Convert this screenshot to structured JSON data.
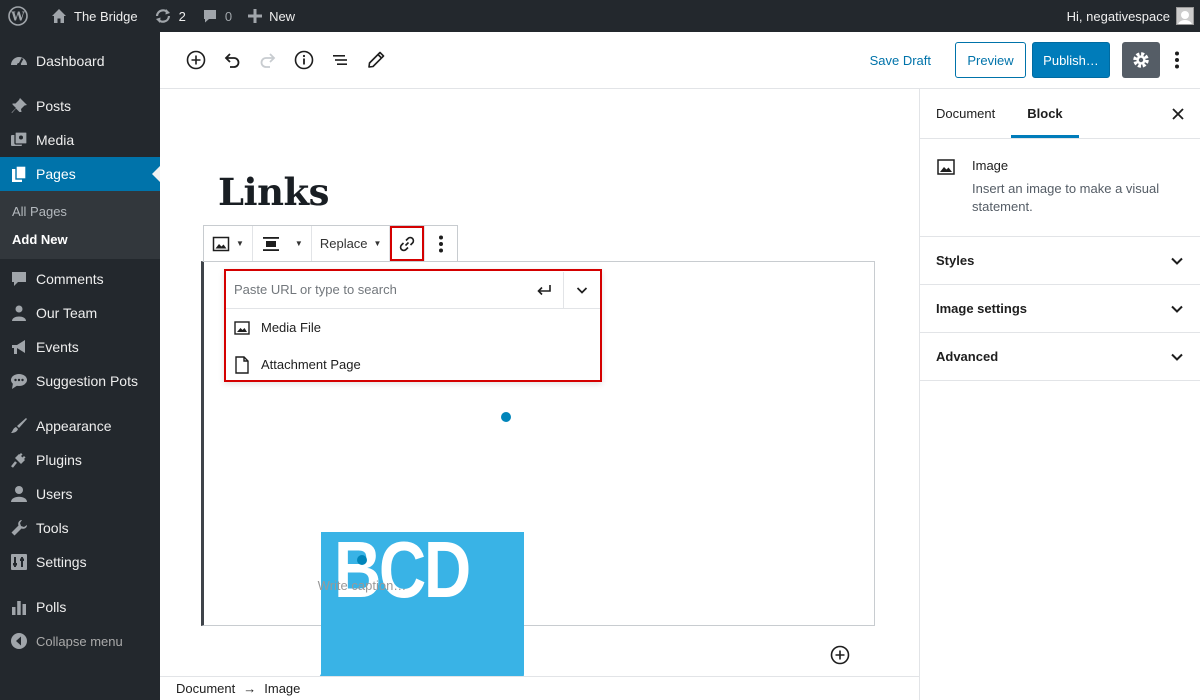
{
  "admin_bar": {
    "site_name": "The Bridge",
    "updates_count": "2",
    "comments_count": "0",
    "new_label": "New",
    "greeting": "Hi, negativespace"
  },
  "sidebar": {
    "items": [
      {
        "label": "Dashboard",
        "icon": "dashboard-icon"
      },
      {
        "label": "Posts",
        "icon": "pushpin-icon"
      },
      {
        "label": "Media",
        "icon": "media-icon"
      },
      {
        "label": "Pages",
        "icon": "pages-icon"
      },
      {
        "label": "Comments",
        "icon": "comments-icon"
      },
      {
        "label": "Our Team",
        "icon": "users-icon"
      },
      {
        "label": "Events",
        "icon": "megaphone-icon"
      },
      {
        "label": "Suggestion Pots",
        "icon": "comments-icon"
      },
      {
        "label": "Appearance",
        "icon": "brush-icon"
      },
      {
        "label": "Plugins",
        "icon": "plug-icon"
      },
      {
        "label": "Users",
        "icon": "user-icon"
      },
      {
        "label": "Tools",
        "icon": "wrench-icon"
      },
      {
        "label": "Settings",
        "icon": "settings-icon"
      },
      {
        "label": "Polls",
        "icon": "chart-bar-icon"
      }
    ],
    "pages_submenu": [
      "All Pages",
      "Add New"
    ],
    "collapse_label": "Collapse menu"
  },
  "editor_header": {
    "save_draft": "Save Draft",
    "preview": "Preview",
    "publish": "Publish…"
  },
  "content": {
    "title": "Links",
    "caption_placeholder": "Write caption…",
    "image_text": "BCD"
  },
  "block_toolbar": {
    "replace_label": "Replace"
  },
  "link_popover": {
    "placeholder": "Paste URL or type to search",
    "options": [
      "Media File",
      "Attachment Page"
    ]
  },
  "breadcrumb": {
    "items": [
      "Document",
      "Image"
    ],
    "separator": "→"
  },
  "inspector": {
    "tabs": [
      "Document",
      "Block"
    ],
    "block_name": "Image",
    "block_description": "Insert an image to make a visual statement.",
    "panels": [
      "Styles",
      "Image settings",
      "Advanced"
    ]
  },
  "colors": {
    "admin_dark": "#23282d",
    "active_blue": "#0073aa",
    "highlight_red": "#d40000",
    "image_blue": "#39b3e6"
  }
}
